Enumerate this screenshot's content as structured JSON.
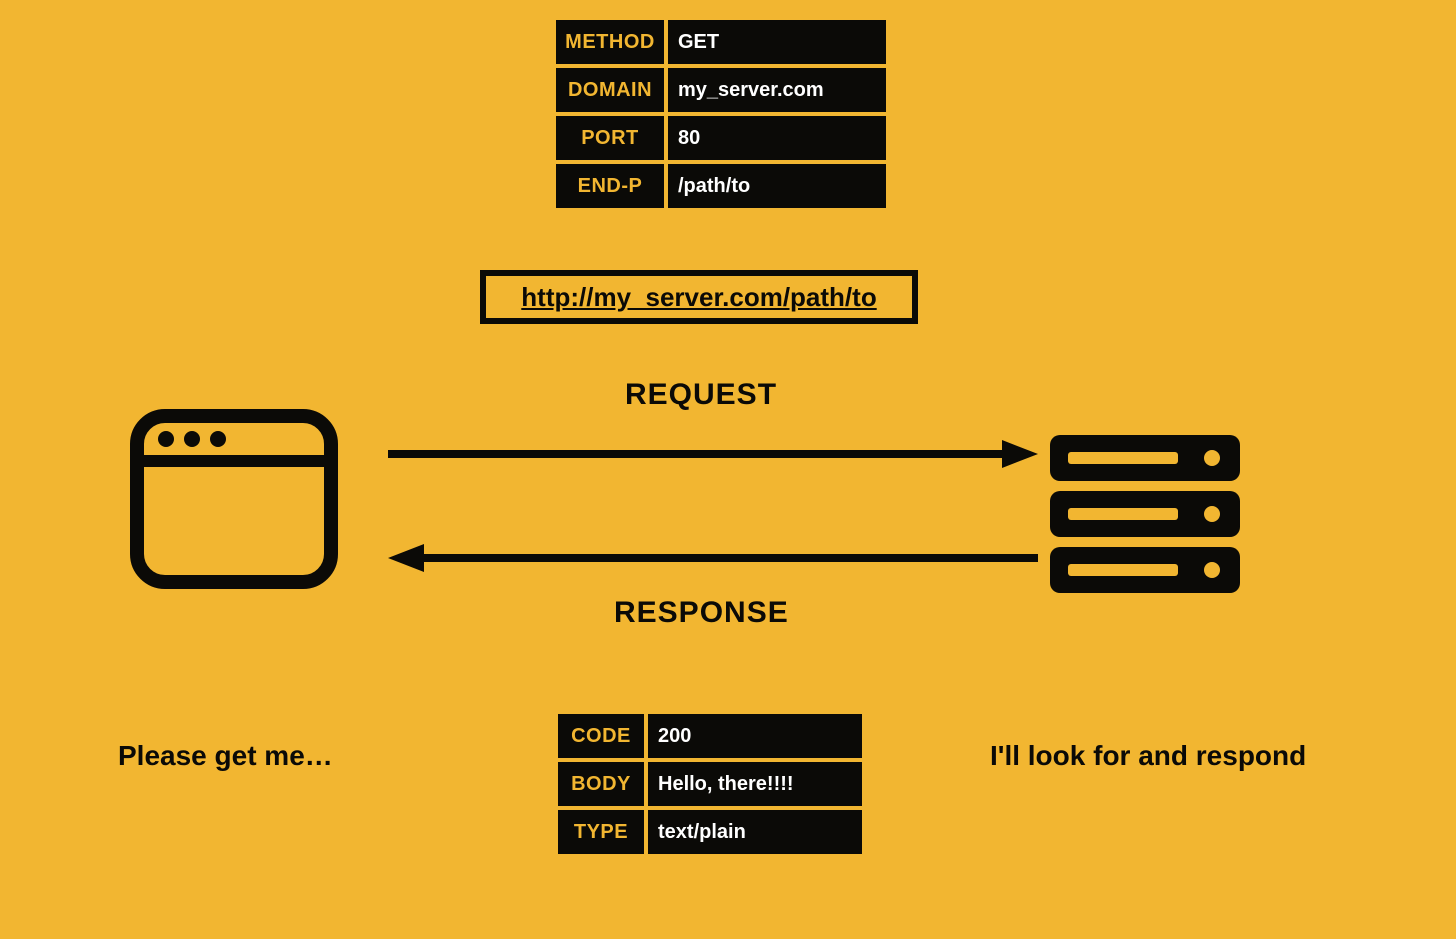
{
  "request_table": {
    "rows": [
      {
        "key": "METHOD",
        "val": "GET"
      },
      {
        "key": "DOMAIN",
        "val": "my_server.com"
      },
      {
        "key": "PORT",
        "val": "80"
      },
      {
        "key": "END-P",
        "val": "/path/to"
      }
    ]
  },
  "full_url": "http://my_server.com/path/to",
  "labels": {
    "request": "REQUEST",
    "response": "RESPONSE"
  },
  "client_caption": "Please get me…",
  "server_caption": "I'll look for and respond",
  "response_table": {
    "rows": [
      {
        "key": "CODE",
        "val": "200"
      },
      {
        "key": "BODY",
        "val": "Hello, there!!!!"
      },
      {
        "key": "TYPE",
        "val": "text/plain"
      }
    ]
  },
  "colors": {
    "background": "#f2b631",
    "ink": "#0b0a07",
    "value_text": "#ffffff"
  }
}
